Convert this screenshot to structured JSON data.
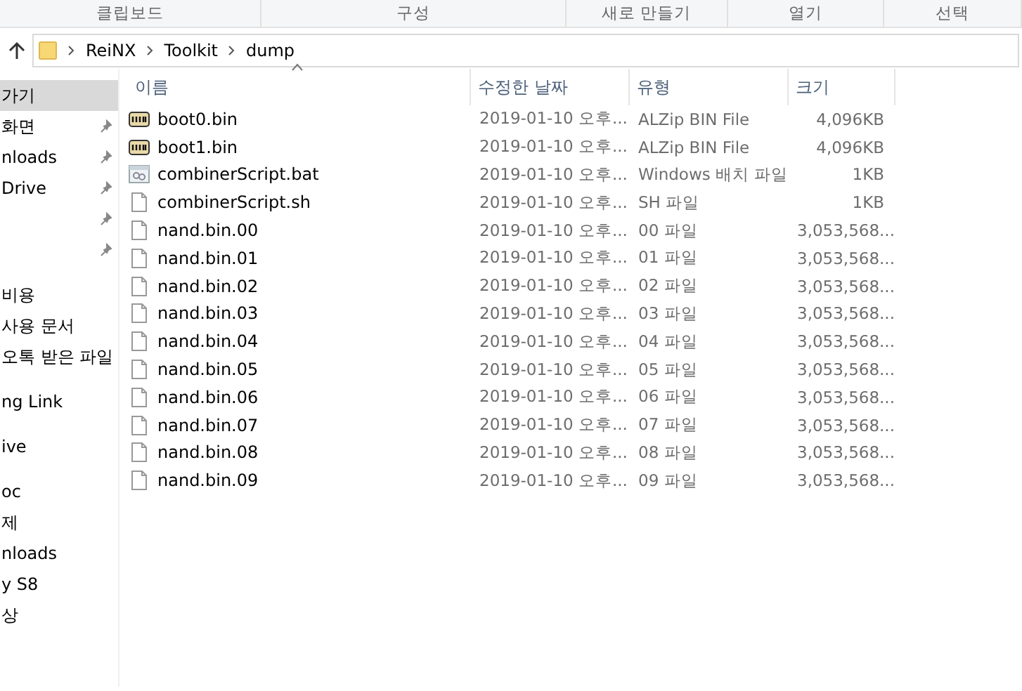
{
  "ribbon_groups": [
    "클립보드",
    "구성",
    "새로 만들기",
    "열기",
    "선택"
  ],
  "address_bar": {
    "path": [
      "ReiNX",
      "Toolkit",
      "dump"
    ]
  },
  "sidebar": {
    "groups": [
      {
        "items": [
          {
            "label": "가기",
            "pinned": false,
            "selected": true
          },
          {
            "label": "화면",
            "pinned": true,
            "selected": false
          },
          {
            "label": "nloads",
            "pinned": true,
            "selected": false
          },
          {
            "label": "Drive",
            "pinned": true,
            "selected": false
          },
          {
            "pinned": true,
            "selected": false
          },
          {
            "pinned": true,
            "selected": false
          }
        ]
      },
      {
        "items": [
          {
            "label": "비용",
            "pinned": false,
            "selected": false
          },
          {
            "label": "사용 문서",
            "pinned": false,
            "selected": false
          },
          {
            "label": "오톡 받은 파일",
            "pinned": false,
            "selected": false
          }
        ]
      },
      {
        "items": [
          {
            "label": "ng Link",
            "pinned": false,
            "selected": false
          }
        ]
      },
      {
        "items": [
          {
            "label": "ive",
            "pinned": false,
            "selected": false
          }
        ]
      },
      {
        "items": [
          {
            "label": "oc",
            "pinned": false,
            "selected": false
          },
          {
            "label": "제",
            "pinned": false,
            "selected": false
          },
          {
            "label": "nloads",
            "pinned": false,
            "selected": false
          },
          {
            "label": "y S8",
            "pinned": false,
            "selected": false
          },
          {
            "label": "상",
            "pinned": false,
            "selected": false
          }
        ]
      }
    ]
  },
  "table": {
    "columns": [
      "이름",
      "수정한 날짜",
      "유형",
      "크기"
    ],
    "rows": [
      {
        "kind": "bin",
        "name": "boot0.bin",
        "date": "2019-01-10 오후...",
        "type": "ALZip BIN File",
        "size": "4,096KB"
      },
      {
        "kind": "bin",
        "name": "boot1.bin",
        "date": "2019-01-10 오후...",
        "type": "ALZip BIN File",
        "size": "4,096KB"
      },
      {
        "kind": "batch",
        "name": "combinerScript.bat",
        "date": "2019-01-10 오후...",
        "type": "Windows 배치 파일",
        "size": "1KB"
      },
      {
        "kind": "file",
        "name": "combinerScript.sh",
        "date": "2019-01-10 오후...",
        "type": "SH 파일",
        "size": "1KB"
      },
      {
        "kind": "file",
        "name": "nand.bin.00",
        "date": "2019-01-10 오후...",
        "type": "00 파일",
        "size": "3,053,568..."
      },
      {
        "kind": "file",
        "name": "nand.bin.01",
        "date": "2019-01-10 오후...",
        "type": "01 파일",
        "size": "3,053,568..."
      },
      {
        "kind": "file",
        "name": "nand.bin.02",
        "date": "2019-01-10 오후...",
        "type": "02 파일",
        "size": "3,053,568..."
      },
      {
        "kind": "file",
        "name": "nand.bin.03",
        "date": "2019-01-10 오후...",
        "type": "03 파일",
        "size": "3,053,568..."
      },
      {
        "kind": "file",
        "name": "nand.bin.04",
        "date": "2019-01-10 오후...",
        "type": "04 파일",
        "size": "3,053,568..."
      },
      {
        "kind": "file",
        "name": "nand.bin.05",
        "date": "2019-01-10 오후...",
        "type": "05 파일",
        "size": "3,053,568..."
      },
      {
        "kind": "file",
        "name": "nand.bin.06",
        "date": "2019-01-10 오후...",
        "type": "06 파일",
        "size": "3,053,568..."
      },
      {
        "kind": "file",
        "name": "nand.bin.07",
        "date": "2019-01-10 오후...",
        "type": "07 파일",
        "size": "3,053,568..."
      },
      {
        "kind": "file",
        "name": "nand.bin.08",
        "date": "2019-01-10 오후...",
        "type": "08 파일",
        "size": "3,053,568..."
      },
      {
        "kind": "file",
        "name": "nand.bin.09",
        "date": "2019-01-10 오후...",
        "type": "09 파일",
        "size": "3,053,568..."
      }
    ]
  }
}
